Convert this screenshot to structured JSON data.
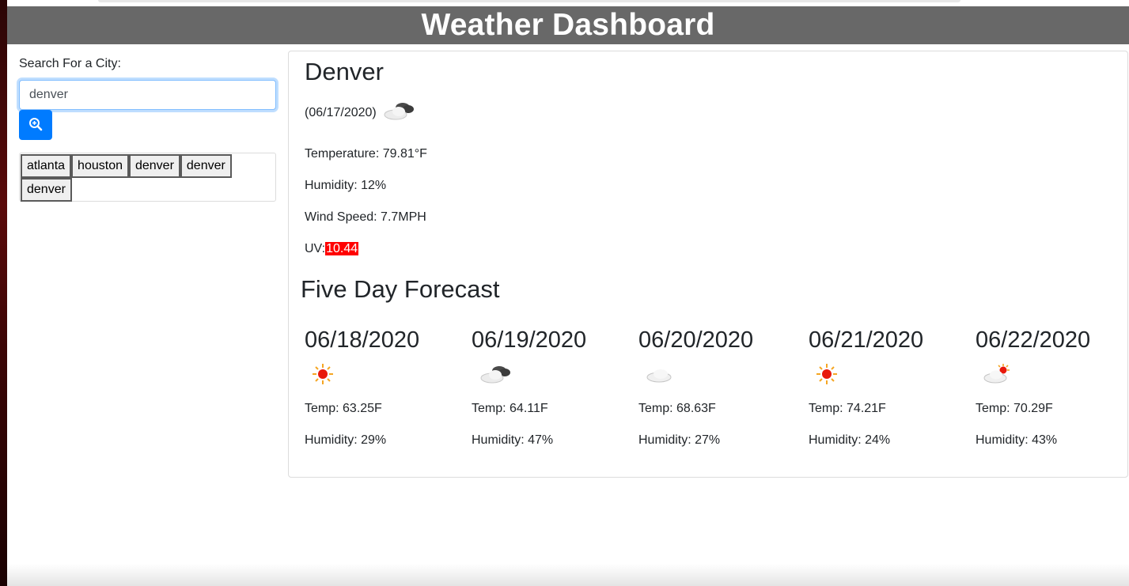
{
  "header": {
    "title": "Weather Dashboard"
  },
  "search": {
    "label": "Search For a City:",
    "value": "denver",
    "button_icon": "search-zoom-icon"
  },
  "history": {
    "items": [
      {
        "label": "atlanta"
      },
      {
        "label": "houston"
      },
      {
        "label": "denver"
      },
      {
        "label": "denver"
      },
      {
        "label": "denver"
      }
    ]
  },
  "current": {
    "city": "Denver",
    "date": "(06/17/2020)",
    "icon": "broken-clouds-icon",
    "temperature": "Temperature: 79.81°F",
    "humidity": "Humidity: 12%",
    "wind": "Wind Speed: 7.7MPH",
    "uv_label": "UV:",
    "uv_value": "10.44",
    "uv_color": "#ff0000"
  },
  "forecast": {
    "title": "Five Day Forecast",
    "days": [
      {
        "date": "06/18/2020",
        "icon": "clear-sun-icon",
        "temp": "Temp: 63.25F",
        "humidity": "Humidity: 29%"
      },
      {
        "date": "06/19/2020",
        "icon": "broken-clouds-icon",
        "temp": "Temp: 64.11F",
        "humidity": "Humidity: 47%"
      },
      {
        "date": "06/20/2020",
        "icon": "scattered-clouds-icon",
        "temp": "Temp: 68.63F",
        "humidity": "Humidity: 27%"
      },
      {
        "date": "06/21/2020",
        "icon": "clear-sun-icon",
        "temp": "Temp: 74.21F",
        "humidity": "Humidity: 24%"
      },
      {
        "date": "06/22/2020",
        "icon": "few-clouds-icon",
        "temp": "Temp: 70.29F",
        "humidity": "Humidity: 43%"
      }
    ]
  },
  "colors": {
    "header_bg": "#686868",
    "button_primary": "#007bff",
    "uv_high": "#ff0000"
  }
}
